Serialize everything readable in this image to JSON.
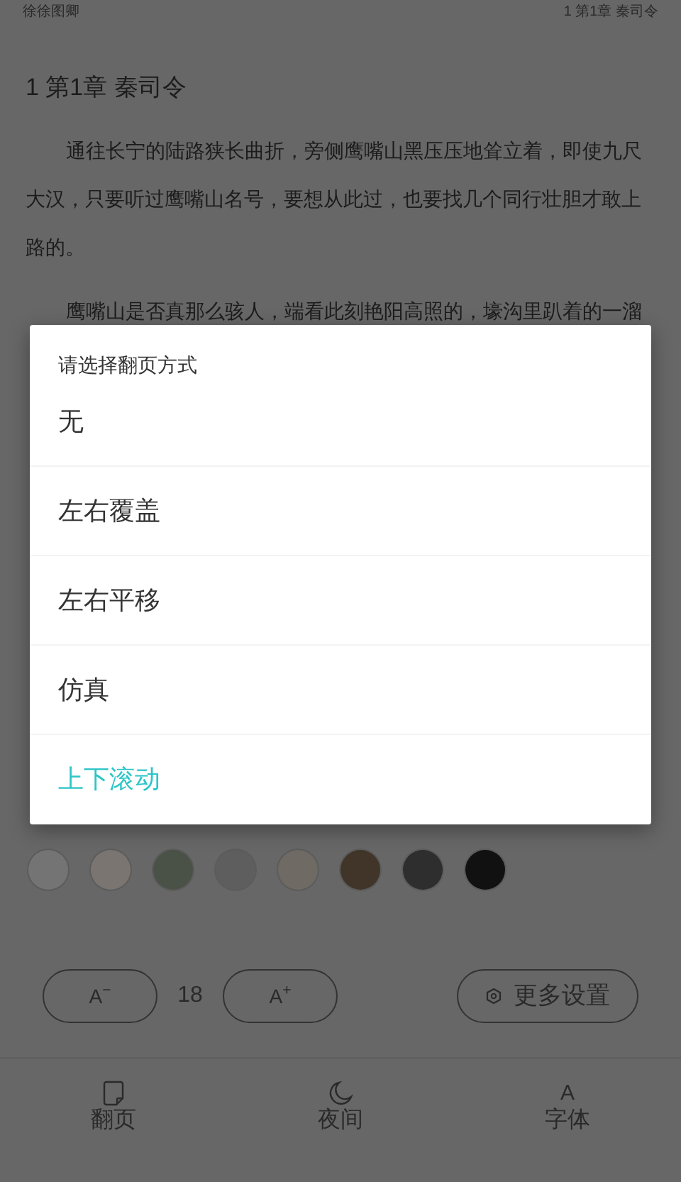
{
  "status_bar": {
    "book": "徐徐图卿",
    "chapter": "1 第1章 秦司令"
  },
  "chapter_title": "1 第1章 秦司令",
  "paragraphs": [
    "通往长宁的陆路狭长曲折，旁侧鹰嘴山黑压压地耸立着，即使九尺大汉，只要听过鹰嘴山名号，要想从此过，也要找几个同行壮胆才敢上路的。",
    "鹰嘴山是否真那么骇人，端看此刻艳阳高照的，壕沟里趴着的一溜"
  ],
  "dialog": {
    "title": "请选择翻页方式",
    "options": [
      {
        "label": "无",
        "selected": false
      },
      {
        "label": "左右覆盖",
        "selected": false
      },
      {
        "label": "左右平移",
        "selected": false
      },
      {
        "label": "仿真",
        "selected": false
      },
      {
        "label": "上下滚动",
        "selected": true
      }
    ]
  },
  "themes": [
    {
      "color": "#747474"
    },
    {
      "color": "#7a7570"
    },
    {
      "color": "#4a5248"
    },
    {
      "color": "#5e5e5e"
    },
    {
      "color": "#6f6a64"
    },
    {
      "color": "#41352a"
    },
    {
      "color": "#2e2e2e"
    },
    {
      "color": "#111111"
    }
  ],
  "font_size": {
    "decrease": "A$^{−}$",
    "value": "18",
    "increase": "A$^{+}$"
  },
  "more_settings": "更多设置",
  "nav": [
    {
      "kind": "page",
      "label": "翻页"
    },
    {
      "kind": "moon",
      "label": "夜间"
    },
    {
      "kind": "font",
      "glyph": "A",
      "label": "字体"
    }
  ]
}
